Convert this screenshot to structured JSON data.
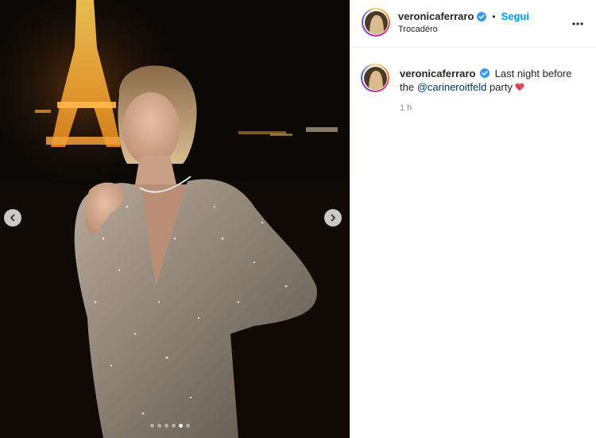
{
  "post": {
    "username": "veronicaferraro",
    "follow_label": "Segui",
    "separator": "•",
    "location": "Trocadéro",
    "caption_text_before": "Last night before the",
    "caption_mention": "@carineroitfeld",
    "caption_text_after": "party",
    "timestamp": "1 h"
  },
  "carousel": {
    "total_images": 6,
    "active_index": 4
  },
  "colors": {
    "accent": "#0095f6",
    "mention": "#00376b",
    "verified": "#3897f0",
    "heart": "#ed4956"
  },
  "icons": {
    "prev": "chevron-left-icon",
    "next": "chevron-right-icon",
    "more": "more-options-icon",
    "verified": "verified-badge-icon",
    "heart": "heart-emoji-icon"
  }
}
